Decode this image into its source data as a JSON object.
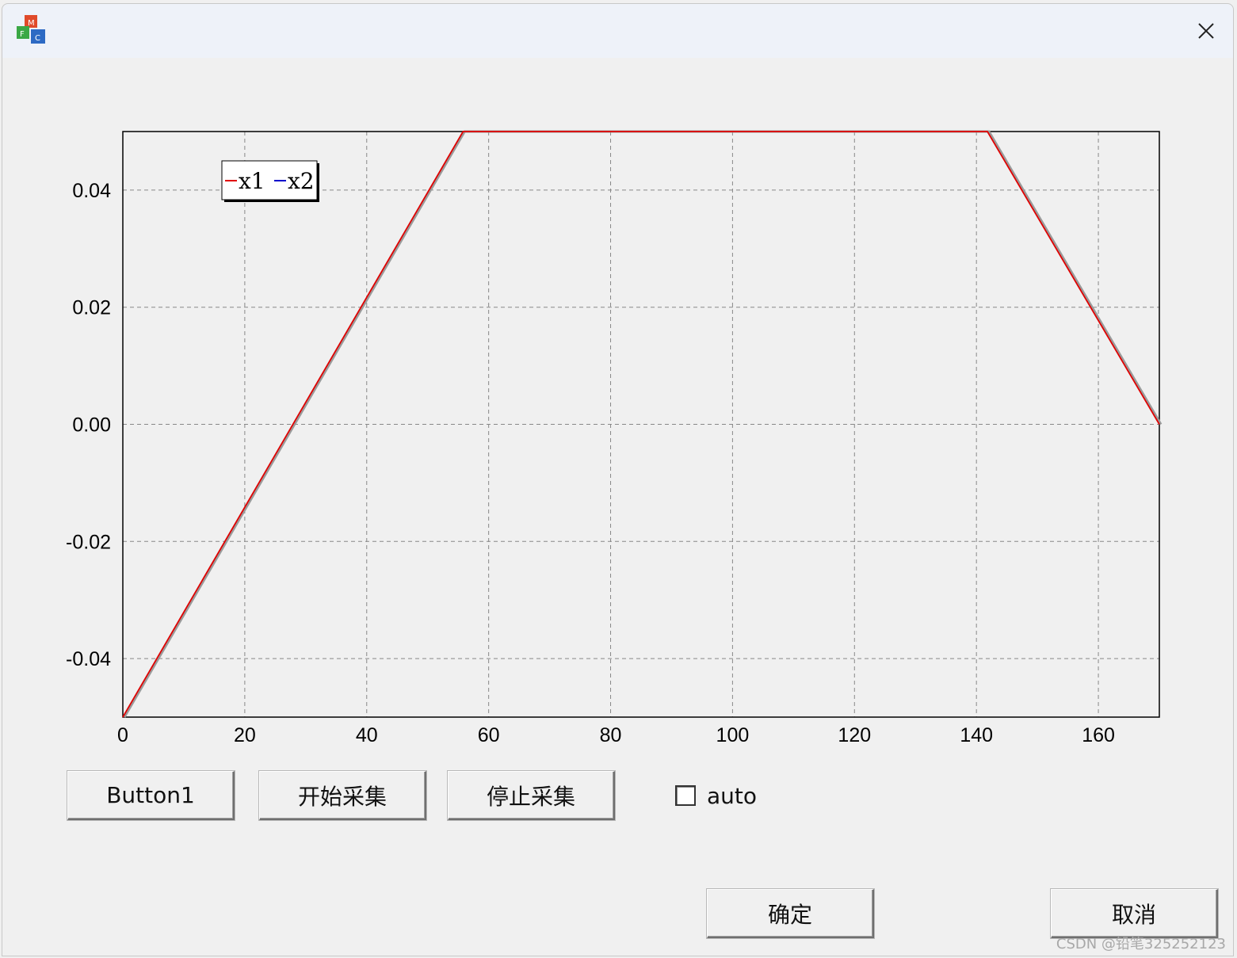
{
  "window": {
    "close_label": "×"
  },
  "buttons": {
    "button1": "Button1",
    "start": "开始采集",
    "stop": "停止采集",
    "ok": "确定",
    "cancel": "取消"
  },
  "checkbox": {
    "label": "auto",
    "checked": false
  },
  "watermark": "CSDN @铅笔325252123",
  "colors": {
    "series_x1": "#e00000",
    "series_x2": "#0000cc",
    "grid": "#888888",
    "background": "#f0f0f0"
  },
  "chart_data": {
    "type": "line",
    "xlim": [
      0,
      170
    ],
    "ylim": [
      -0.05,
      0.05
    ],
    "x_ticks": [
      0,
      20,
      40,
      60,
      80,
      100,
      120,
      140,
      160
    ],
    "y_ticks": [
      -0.04,
      -0.02,
      0.0,
      0.02,
      0.04
    ],
    "x_tick_labels": [
      "0",
      "20",
      "40",
      "60",
      "80",
      "100",
      "120",
      "140",
      "160"
    ],
    "y_tick_labels": [
      "-0.04",
      "-0.02",
      "0.00",
      "0.02",
      "0.04"
    ],
    "grid": true,
    "legend": {
      "placement": "top-left",
      "entries": [
        "x1",
        "x2"
      ]
    },
    "series": [
      {
        "name": "x1",
        "color": "#e00000",
        "x": [
          0,
          55.8,
          141.8,
          170
        ],
        "y": [
          -0.05,
          0.05,
          0.05,
          0.0
        ]
      },
      {
        "name": "x2",
        "color": "#0000cc",
        "x": [
          0,
          55.8,
          141.8,
          170
        ],
        "y": [
          -0.05,
          0.05,
          0.05,
          0.0
        ]
      }
    ]
  }
}
